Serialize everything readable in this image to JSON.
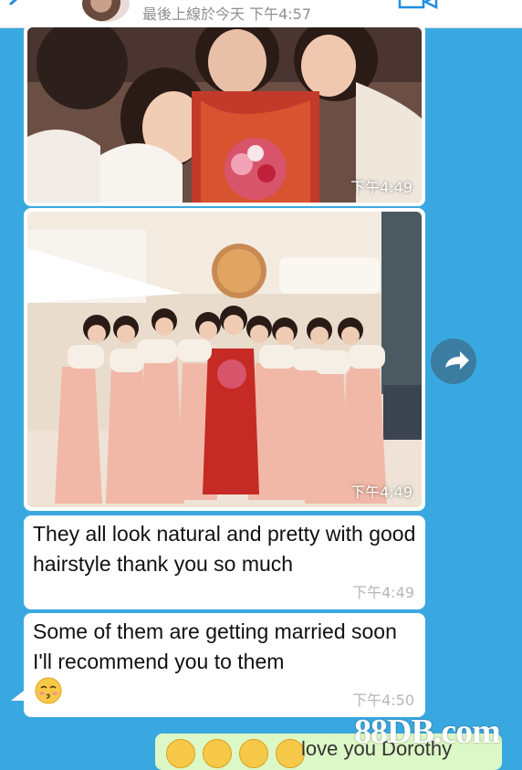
{
  "header": {
    "last_seen": "最後上線於今天 下午4:57"
  },
  "messages": [
    {
      "type": "photo",
      "time": "下午4:49"
    },
    {
      "type": "photo",
      "time": "下午4:49"
    },
    {
      "type": "text",
      "text": "They all look natural and pretty with good hairstyle thank you so much",
      "time": "下午4:49"
    },
    {
      "type": "text",
      "text": "Some of them are getting married soon I'll recommend you to them",
      "emoji": "kissing-face",
      "time": "下午4:50"
    }
  ],
  "outgoing": {
    "emojis": [
      "smiling-face",
      "smiling-face",
      "smiling-face",
      "smiling-face"
    ],
    "text": "love you Dorothy"
  },
  "watermark": "88DB.com",
  "colors": {
    "background": "#3aa8e0",
    "bubble_incoming": "#ffffff",
    "bubble_outgoing": "#dcf8c6",
    "time_text": "#b6b6b6"
  }
}
